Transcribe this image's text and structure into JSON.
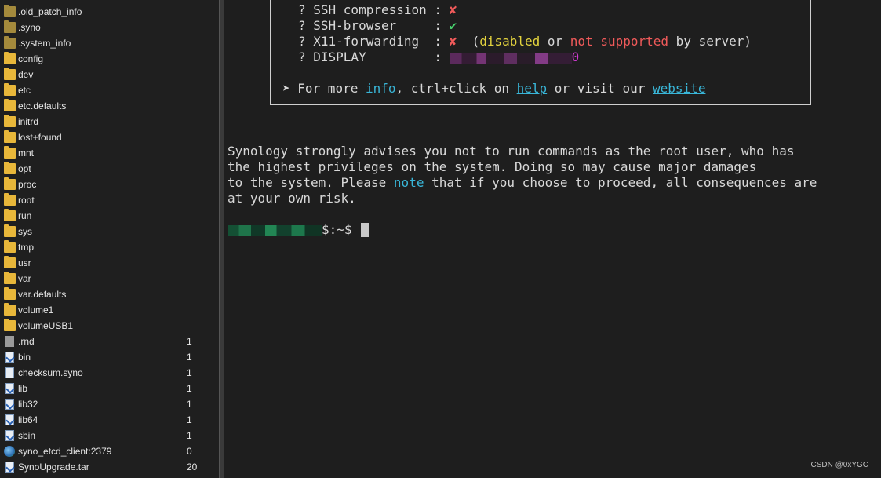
{
  "sidebar": {
    "files": [
      {
        "name": ".old_patch_info",
        "size": "",
        "icon": "folder-hidden-icon"
      },
      {
        "name": ".syno",
        "size": "",
        "icon": "folder-hidden-icon"
      },
      {
        "name": ".system_info",
        "size": "",
        "icon": "folder-hidden-icon"
      },
      {
        "name": "config",
        "size": "",
        "icon": "folder-icon"
      },
      {
        "name": "dev",
        "size": "",
        "icon": "folder-icon"
      },
      {
        "name": "etc",
        "size": "",
        "icon": "folder-icon"
      },
      {
        "name": "etc.defaults",
        "size": "",
        "icon": "folder-icon"
      },
      {
        "name": "initrd",
        "size": "",
        "icon": "folder-icon"
      },
      {
        "name": "lost+found",
        "size": "",
        "icon": "folder-icon"
      },
      {
        "name": "mnt",
        "size": "",
        "icon": "folder-icon"
      },
      {
        "name": "opt",
        "size": "",
        "icon": "folder-icon"
      },
      {
        "name": "proc",
        "size": "",
        "icon": "folder-icon"
      },
      {
        "name": "root",
        "size": "",
        "icon": "folder-icon"
      },
      {
        "name": "run",
        "size": "",
        "icon": "folder-icon"
      },
      {
        "name": "sys",
        "size": "",
        "icon": "folder-icon"
      },
      {
        "name": "tmp",
        "size": "",
        "icon": "folder-icon"
      },
      {
        "name": "usr",
        "size": "",
        "icon": "folder-icon"
      },
      {
        "name": "var",
        "size": "",
        "icon": "folder-icon"
      },
      {
        "name": "var.defaults",
        "size": "",
        "icon": "folder-icon"
      },
      {
        "name": "volume1",
        "size": "",
        "icon": "folder-icon"
      },
      {
        "name": "volumeUSB1",
        "size": "",
        "icon": "folder-icon"
      },
      {
        "name": ".rnd",
        "size": "1",
        "icon": "file-icon"
      },
      {
        "name": "bin",
        "size": "1",
        "icon": "symlink-icon"
      },
      {
        "name": "checksum.syno",
        "size": "1",
        "icon": "document-icon"
      },
      {
        "name": "lib",
        "size": "1",
        "icon": "symlink-icon"
      },
      {
        "name": "lib32",
        "size": "1",
        "icon": "symlink-icon"
      },
      {
        "name": "lib64",
        "size": "1",
        "icon": "symlink-icon"
      },
      {
        "name": "sbin",
        "size": "1",
        "icon": "symlink-icon"
      },
      {
        "name": "syno_etcd_client:2379",
        "size": "0",
        "icon": "globe-icon"
      },
      {
        "name": "SynoUpgrade.tar",
        "size": "20",
        "icon": "symlink-icon"
      }
    ]
  },
  "terminal": {
    "banner": {
      "line1_prefix": "? SSH compression",
      "line1_sep": " : ",
      "line1_mark": "✘",
      "line2_prefix": "? SSH-browser",
      "line2_sep": "     : ",
      "line2_mark": "✔",
      "line3_prefix": "? X11-forwarding",
      "line3_sep": "  : ",
      "line3_mark": "✘",
      "line3_paren_open": "  (",
      "line3_disabled": "disabled",
      "line3_or": " or ",
      "line3_not": "not",
      "line3_space": " ",
      "line3_supported": "supported",
      "line3_tail": " by server)",
      "line4_prefix": "? DISPLAY",
      "line4_sep": "         : ",
      "line4_suffix": "0",
      "info_arrow": "➤",
      "info_1": " For more ",
      "info_word": "info",
      "info_2": ", ctrl+click on ",
      "info_help": "help",
      "info_3": " or visit our ",
      "info_website": "website"
    },
    "warning": {
      "l1": "Synology strongly advises you not to run commands as the root user, who has",
      "l2": "the highest privileges on the system. Doing so may cause major damages",
      "l3_a": "to the system. Please ",
      "l3_note": "note",
      "l3_b": " that if you choose to proceed, all consequences are",
      "l4": "at your own risk."
    },
    "prompt": {
      "suffix": "$:~$"
    }
  },
  "watermark": "CSDN @0xYGC"
}
